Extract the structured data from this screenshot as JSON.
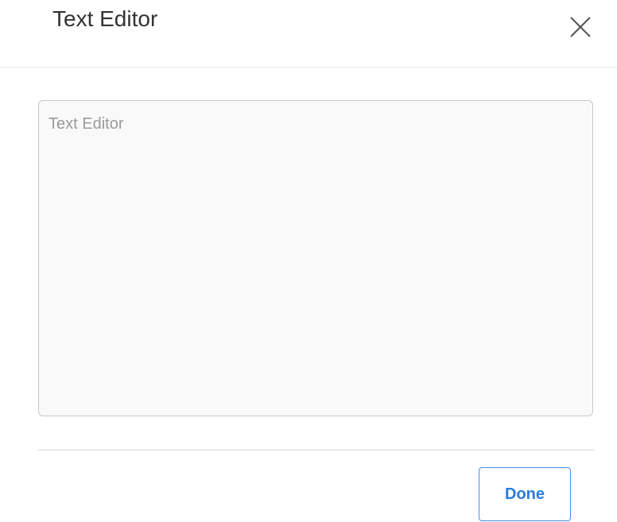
{
  "dialog": {
    "title": "Text Editor",
    "close_icon": "close-icon"
  },
  "editor": {
    "value": "",
    "placeholder": "Text Editor"
  },
  "footer": {
    "done_label": "Done"
  },
  "colors": {
    "accent": "#2b7bd9",
    "border": "#c8c8c8",
    "placeholder": "#9a9a9a"
  }
}
